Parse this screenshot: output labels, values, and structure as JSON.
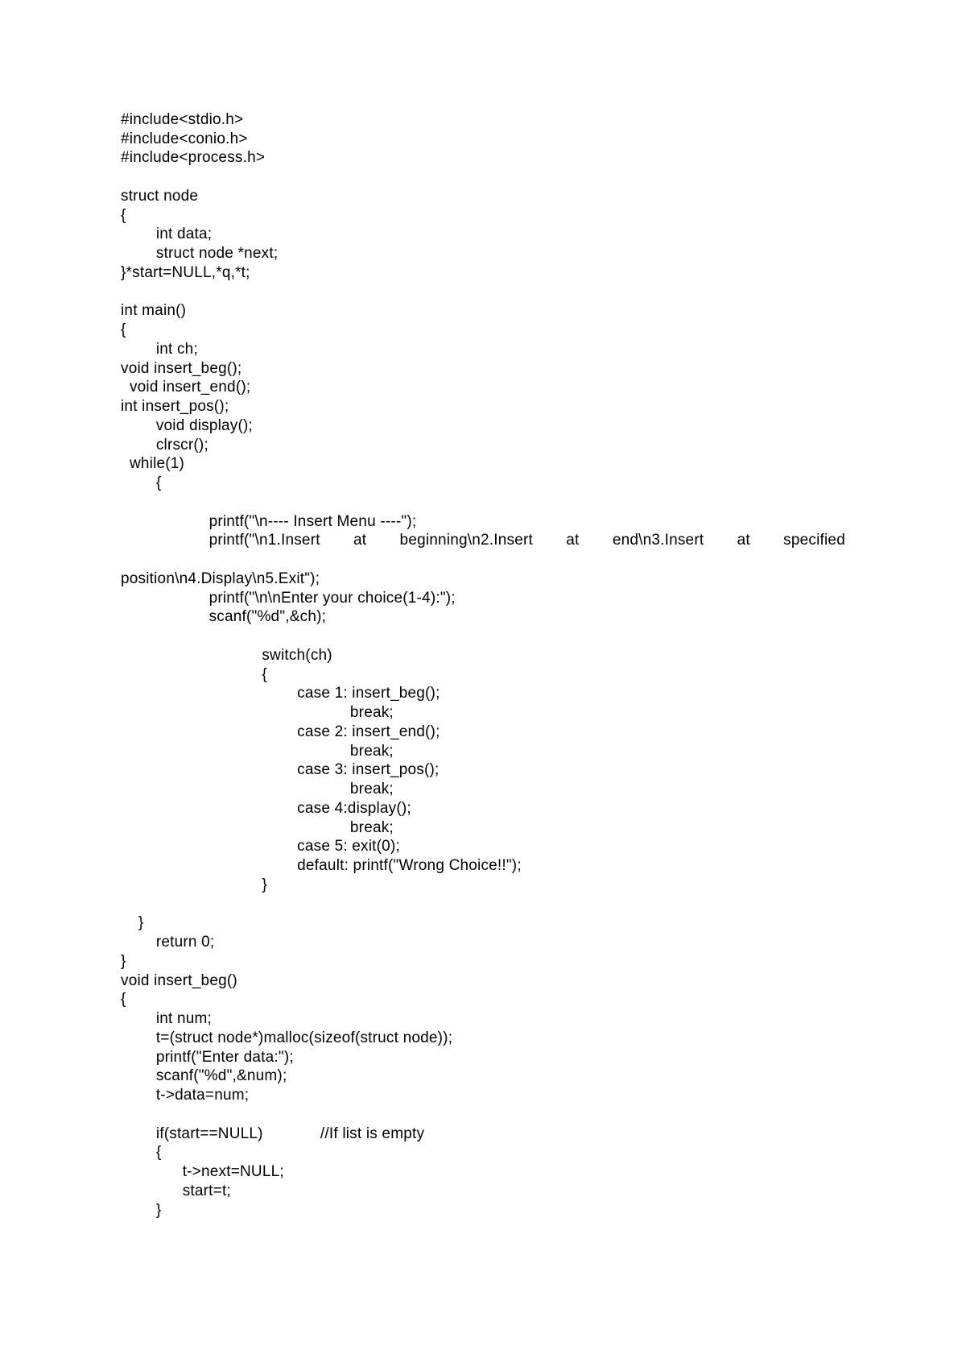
{
  "code": {
    "l1": "#include<stdio.h>",
    "l2": "#include<conio.h>",
    "l3": "#include<process.h>",
    "l4": "",
    "l5": "struct node",
    "l6": "{",
    "l7": "        int data;",
    "l8": "        struct node *next;",
    "l9": "}*start=NULL,*q,*t;",
    "l10": "",
    "l11": "int main()",
    "l12": "{",
    "l13": "        int ch;",
    "l14": "void insert_beg();",
    "l15": "  void insert_end();",
    "l16": "int insert_pos();",
    "l17": "        void display();",
    "l18": "        clrscr();",
    "l19": "  while(1)",
    "l20": "        {",
    "l21": "",
    "l22": "                    printf(\"\\n---- Insert Menu ----\");",
    "l23a": "                    printf(\"\\n1.Insert",
    "l23b": "at",
    "l23c": "beginning\\n2.Insert",
    "l23d": "at",
    "l23e": "end\\n3.Insert",
    "l23f": "at",
    "l23g": "specified",
    "l24": "position\\n4.Display\\n5.Exit\");",
    "l25": "                    printf(\"\\n\\nEnter your choice(1-4):\");",
    "l26": "                    scanf(\"%d\",&ch);",
    "l27": "",
    "l28": "                                switch(ch)",
    "l29": "                                {",
    "l30": "                                        case 1: insert_beg();",
    "l31": "                                                    break;",
    "l32": "                                        case 2: insert_end();",
    "l33": "                                                    break;",
    "l34": "                                        case 3: insert_pos();",
    "l35": "                                                    break;",
    "l36": "                                        case 4:display();",
    "l37": "                                                    break;",
    "l38": "                                        case 5: exit(0);",
    "l39": "                                        default: printf(\"Wrong Choice!!\");",
    "l40": "                                }",
    "l41": "",
    "l42": "    }",
    "l43": "        return 0;",
    "l44": "}",
    "l45": "void insert_beg()",
    "l46": "{",
    "l47": "        int num;",
    "l48": "        t=(struct node*)malloc(sizeof(struct node));",
    "l49": "        printf(\"Enter data:\");",
    "l50": "        scanf(\"%d\",&num);",
    "l51": "        t->data=num;",
    "l52": "",
    "l53": "        if(start==NULL)             //If list is empty",
    "l54": "        {",
    "l55": "              t->next=NULL;",
    "l56": "              start=t;",
    "l57": "        }"
  }
}
